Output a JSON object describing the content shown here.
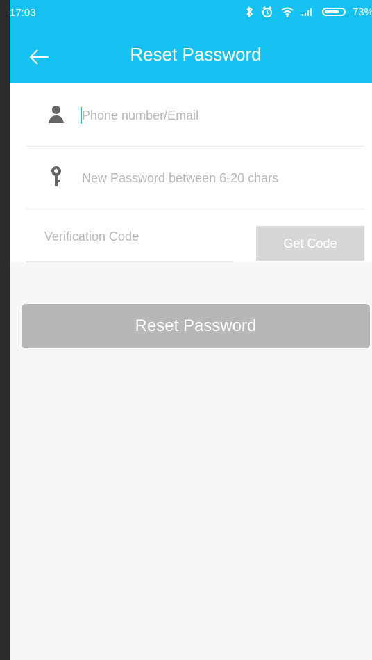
{
  "status_bar": {
    "time": "17:03",
    "battery_level": "73%"
  },
  "toolbar": {
    "title": "Reset Password",
    "back_icon": "back-arrow-icon"
  },
  "form": {
    "phone_email": {
      "placeholder": "Phone number/Email",
      "icon": "user-icon"
    },
    "new_password": {
      "placeholder": "New Password between 6-20 chars",
      "icon": "key-icon"
    },
    "verification_code": {
      "placeholder": "Verification Code",
      "button_label": "Get Code"
    }
  },
  "actions": {
    "reset_label": "Reset Password"
  },
  "colors": {
    "primary": "#14c1f1",
    "disabled_button": "#b7b7b7",
    "get_code_button": "#d7d7d7"
  }
}
